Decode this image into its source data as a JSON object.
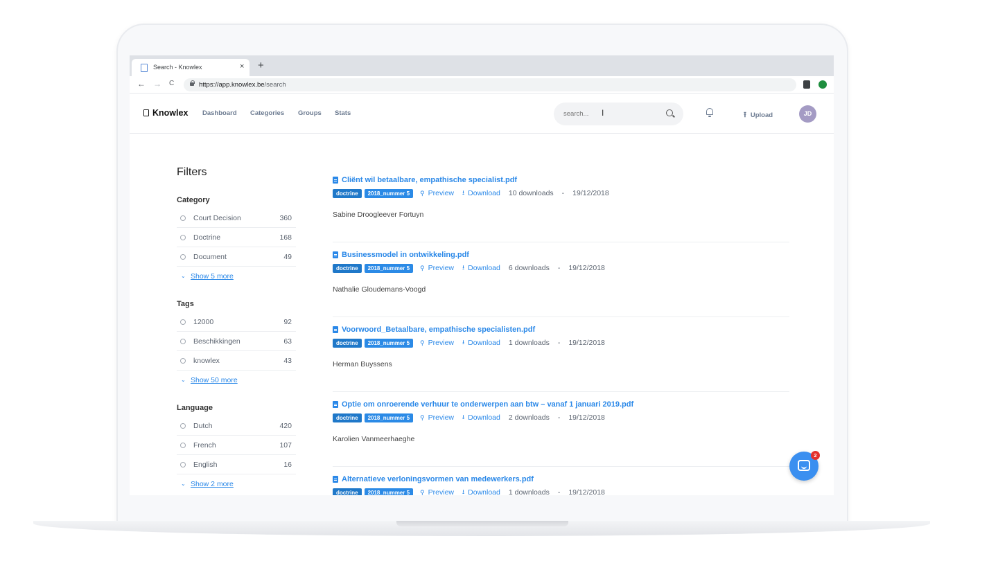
{
  "browser": {
    "tab_title": "Search - Knowlex",
    "close_glyph": "×",
    "new_tab_glyph": "+",
    "url_host": "https://app.knowlex.be",
    "url_path": "/search",
    "back_glyph": "←",
    "forward_glyph": "→",
    "reload_glyph": "C"
  },
  "header": {
    "brand": "Knowlex",
    "nav": [
      "Dashboard",
      "Categories",
      "Groups",
      "Stats"
    ],
    "search_placeholder": "search...",
    "upload_label": "Upload",
    "avatar_initials": "JD"
  },
  "filters": {
    "title": "Filters",
    "sections": [
      {
        "heading": "Category",
        "items": [
          {
            "label": "Court Decision",
            "count": "360"
          },
          {
            "label": "Doctrine",
            "count": "168"
          },
          {
            "label": "Document",
            "count": "49"
          }
        ],
        "more": "Show 5 more"
      },
      {
        "heading": "Tags",
        "items": [
          {
            "label": "12000",
            "count": "92"
          },
          {
            "label": "Beschikkingen",
            "count": "63"
          },
          {
            "label": "knowlex",
            "count": "43"
          }
        ],
        "more": "Show 50 more"
      },
      {
        "heading": "Language",
        "items": [
          {
            "label": "Dutch",
            "count": "420"
          },
          {
            "label": "French",
            "count": "107"
          },
          {
            "label": "English",
            "count": "16"
          }
        ],
        "more": "Show 2 more"
      }
    ]
  },
  "results": [
    {
      "title": "Cliënt wil betaalbare, empathische specialist.pdf",
      "badge1": "doctrine",
      "badge2": "2018_nummer 5",
      "preview": "Preview",
      "download": "Download",
      "downloads": "10 downloads",
      "sep": "-",
      "date": "19/12/2018",
      "author": "Sabine Droogleever Fortuyn"
    },
    {
      "title": "Businessmodel in ontwikkeling.pdf",
      "badge1": "doctrine",
      "badge2": "2018_nummer 5",
      "preview": "Preview",
      "download": "Download",
      "downloads": "6 downloads",
      "sep": "-",
      "date": "19/12/2018",
      "author": "Nathalie Gloudemans-Voogd"
    },
    {
      "title": "Voorwoord_Betaalbare, empathische specialisten.pdf",
      "badge1": "doctrine",
      "badge2": "2018_nummer 5",
      "preview": "Preview",
      "download": "Download",
      "downloads": "1 downloads",
      "sep": "-",
      "date": "19/12/2018",
      "author": "Herman Buyssens"
    },
    {
      "title": "Optie om onroerende verhuur te onderwerpen aan btw – vanaf 1 januari 2019.pdf",
      "badge1": "doctrine",
      "badge2": "2018_nummer 5",
      "preview": "Preview",
      "download": "Download",
      "downloads": "2 downloads",
      "sep": "-",
      "date": "19/12/2018",
      "author": "Karolien Vanmeerhaeghe"
    },
    {
      "title": "Alternatieve verloningsvormen van medewerkers.pdf",
      "badge1": "doctrine",
      "badge2": "2018_nummer 5",
      "preview": "Preview",
      "download": "Download",
      "downloads": "1 downloads",
      "sep": "-",
      "date": "19/12/2018",
      "author": ""
    }
  ],
  "chat": {
    "notification_count": "2"
  },
  "icons": {
    "tab": "document-icon",
    "search": "search-icon",
    "bell": "bell-icon",
    "upload": "upload-icon",
    "preview": "magnifier-icon",
    "download": "download-icon",
    "chat": "chat-icon"
  },
  "colors": {
    "accent": "#2a88e8",
    "badge": "#1f78c9",
    "avatar": "#a49bc4",
    "notification": "#e5322d"
  }
}
